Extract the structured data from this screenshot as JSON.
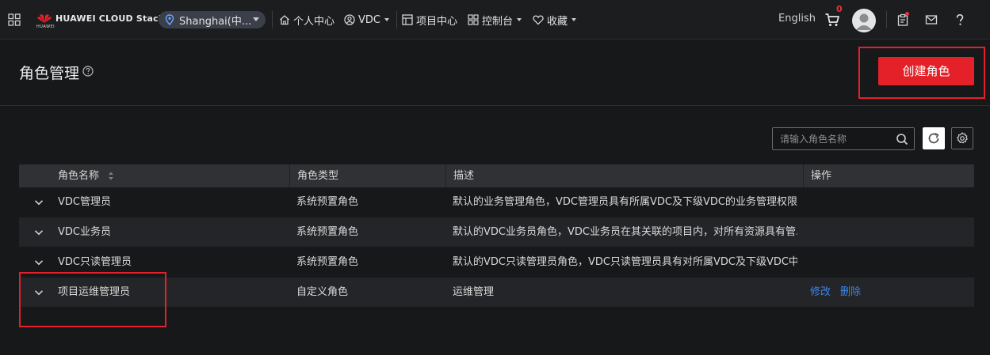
{
  "topbar": {
    "brand_small": "HUAWEI",
    "brand": "HUAWEI CLOUD Stack",
    "region": "Shanghai(中...",
    "nav": [
      {
        "label": "个人中心"
      },
      {
        "label": "VDC"
      },
      {
        "label": "项目中心"
      },
      {
        "label": "控制台"
      },
      {
        "label": "收藏"
      }
    ],
    "language": "English",
    "cart_count": "0"
  },
  "header": {
    "title": "角色管理",
    "create_button": "创建角色"
  },
  "toolbar": {
    "search_placeholder": "请输入角色名称"
  },
  "table": {
    "columns": [
      "角色名称",
      "角色类型",
      "描述",
      "操作"
    ],
    "rows": [
      {
        "name": "VDC管理员",
        "type": "系统预置角色",
        "desc": "默认的业务管理角色，VDC管理员具有所属VDC及下级VDC的业务管理权限...",
        "ops": []
      },
      {
        "name": "VDC业务员",
        "type": "系统预置角色",
        "desc": "默认的VDC业务员角色，VDC业务员在其关联的项目内，对所有资源具有管...",
        "ops": []
      },
      {
        "name": "VDC只读管理员",
        "type": "系统预置角色",
        "desc": "默认的VDC只读管理员角色，VDC只读管理员具有对所属VDC及下级VDC中...",
        "ops": []
      },
      {
        "name": "项目运维管理员",
        "type": "自定义角色",
        "desc": "运维管理",
        "ops": [
          "修改",
          "删除"
        ]
      }
    ]
  },
  "colors": {
    "accent_red": "#e42128",
    "link_blue": "#3a86f0",
    "background": "#17181a"
  }
}
